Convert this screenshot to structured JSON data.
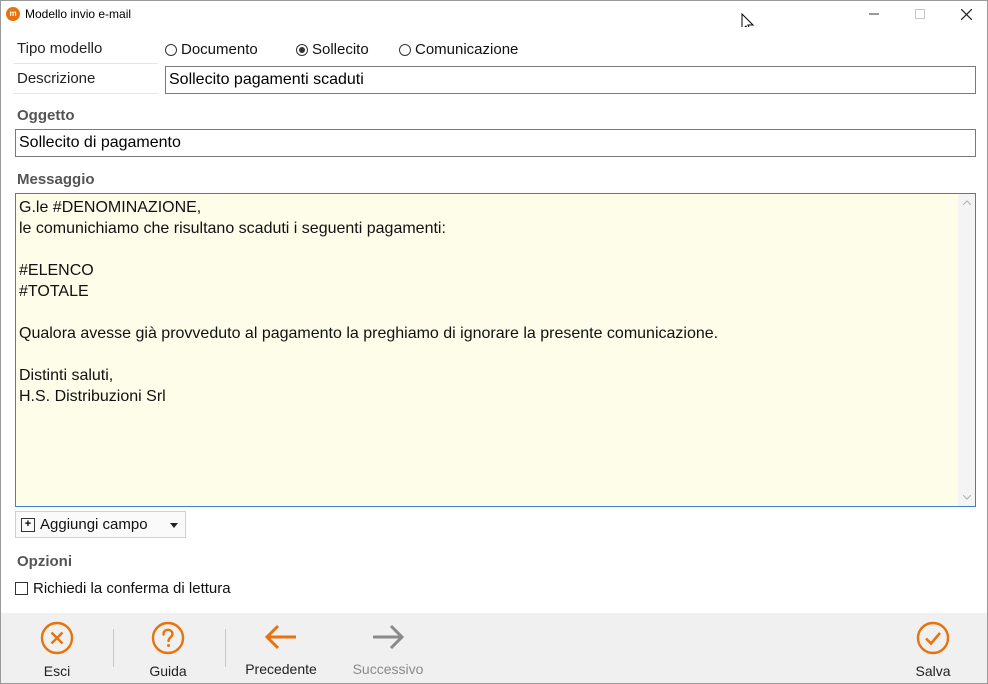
{
  "window": {
    "title": "Modello invio e-mail",
    "app_icon_letter": "m"
  },
  "form": {
    "tipo_modello_label": "Tipo modello",
    "options": [
      {
        "label": "Documento",
        "selected": false
      },
      {
        "label": "Sollecito",
        "selected": true
      },
      {
        "label": "Comunicazione",
        "selected": false
      }
    ],
    "descrizione_label": "Descrizione",
    "descrizione_value": "Sollecito pagamenti scaduti",
    "oggetto_label": "Oggetto",
    "oggetto_value": "Sollecito di pagamento",
    "messaggio_label": "Messaggio",
    "messaggio_value": "G.le #DENOMINAZIONE,\nle comunichiamo che risultano scaduti i seguenti pagamenti:\n\n#ELENCO\n#TOTALE\n\nQualora avesse già provveduto al pagamento la preghiamo di ignorare la presente comunicazione.\n\nDistinti saluti,\nH.S. Distribuzioni Srl",
    "add_field_label": "Aggiungi campo",
    "opzioni_label": "Opzioni",
    "read_receipt_label": "Richiedi la conferma di lettura",
    "read_receipt_checked": false
  },
  "toolbar": {
    "esci": "Esci",
    "guida": "Guida",
    "precedente": "Precedente",
    "successivo": "Successivo",
    "salva": "Salva"
  },
  "colors": {
    "accent": "#e8720c",
    "disabled": "#8a8a8a",
    "message_bg": "#fdfdea",
    "focus_border": "#3c7fd1"
  }
}
